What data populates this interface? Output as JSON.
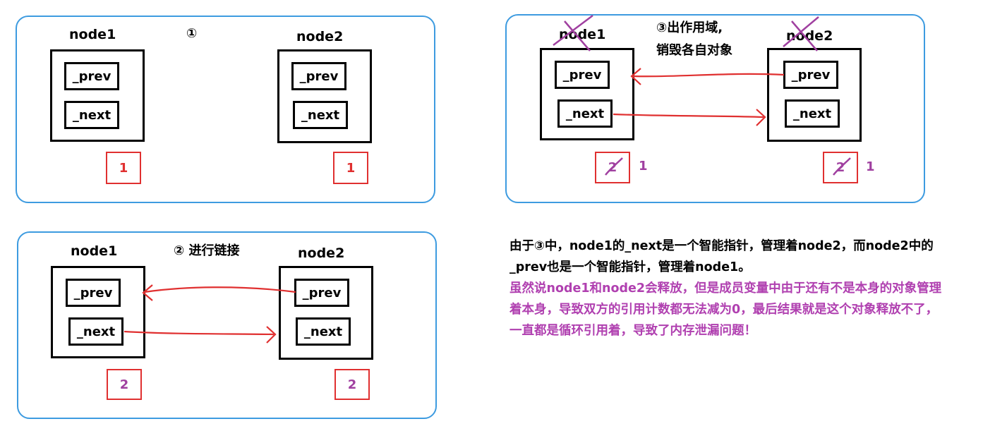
{
  "panel1": {
    "step": "①",
    "node1": {
      "label": "node1",
      "prev": "_prev",
      "next": "_next",
      "count": "1"
    },
    "node2": {
      "label": "node2",
      "prev": "_prev",
      "next": "_next",
      "count": "1"
    }
  },
  "panel2": {
    "step": "② 进行链接",
    "node1": {
      "label": "node1",
      "prev": "_prev",
      "next": "_next",
      "count": "2"
    },
    "node2": {
      "label": "node2",
      "prev": "_prev",
      "next": "_next",
      "count": "2"
    }
  },
  "panel3": {
    "step_line1": "③出作用域,",
    "step_line2": "销毁各自对象",
    "node1": {
      "label": "node1",
      "prev": "_prev",
      "next": "_next",
      "old_count": "2",
      "new_count": "1"
    },
    "node2": {
      "label": "node2",
      "prev": "_prev",
      "next": "_next",
      "old_count": "2",
      "new_count": "1"
    }
  },
  "explanation": {
    "line1": "由于③中，node1的_next是一个智能指针，管理着node2，而node2中的",
    "line2": "_prev也是一个智能指针，管理着node1。",
    "line3": "虽然说node1和node2会释放，但是成员变量中由于还有不是本身的对象管理",
    "line4": "着本身，导致双方的引用计数都无法减为0，最后结果就是这个对象释放不了，",
    "line5": "一直都是循环引用着，导致了内存泄漏问题！"
  },
  "colors": {
    "panel_border": "#3d9be0",
    "count_border": "#e03030",
    "arrow": "#e03030",
    "cross_out": "#a040a0",
    "highlight_text": "#b040b0"
  }
}
